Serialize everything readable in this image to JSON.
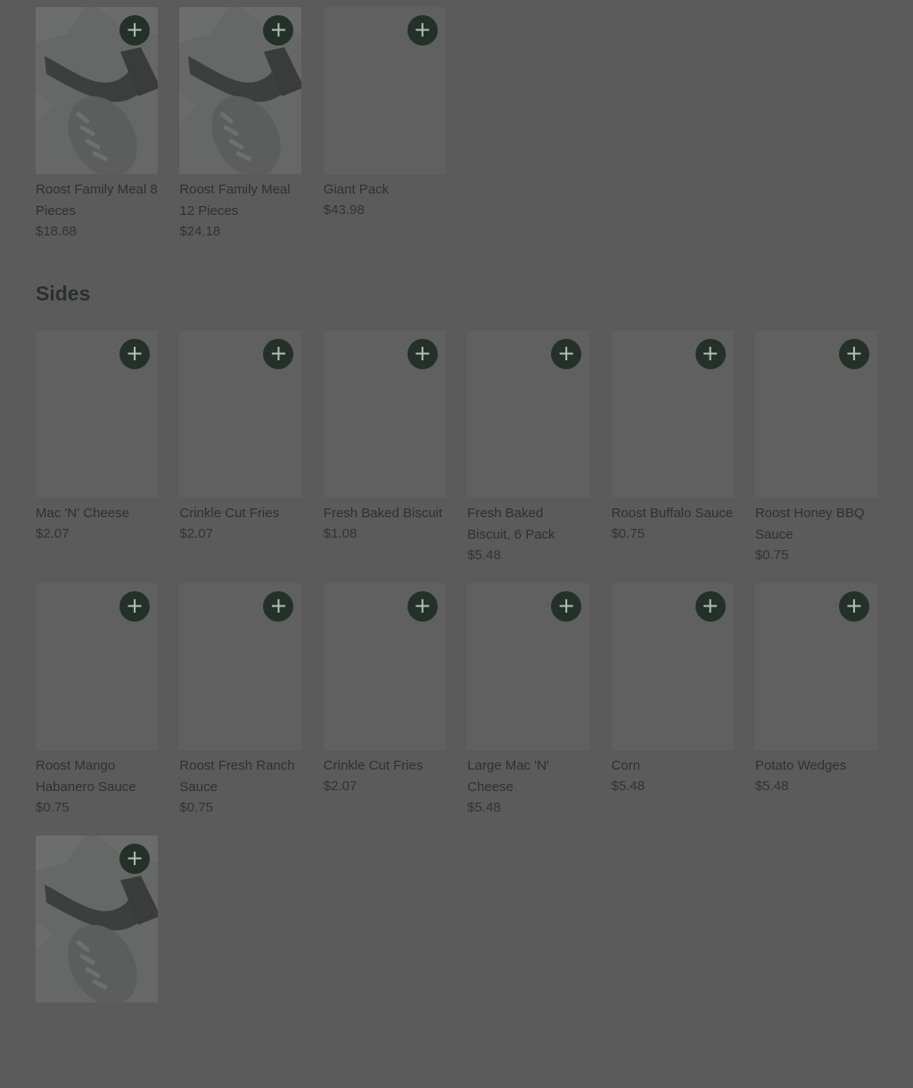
{
  "top_items": [
    {
      "name": "Roost Family Meal 8 Pieces",
      "price": "$18.68",
      "image": "chicken-photo"
    },
    {
      "name": "Roost Family Meal 12 Pieces",
      "price": "$24.18",
      "image": "chicken-photo"
    },
    {
      "name": "Giant Pack",
      "price": "$43.98",
      "image": "blank"
    }
  ],
  "sides": {
    "title": "Sides",
    "items": [
      {
        "name": "Mac 'N' Cheese",
        "price": "$2.07",
        "image": "blank"
      },
      {
        "name": "Crinkle Cut Fries",
        "price": "$2.07",
        "image": "blank"
      },
      {
        "name": "Fresh Baked Biscuit",
        "price": "$1.08",
        "image": "blank"
      },
      {
        "name": "Fresh Baked Biscuit, 6 Pack",
        "price": "$5.48",
        "image": "blank"
      },
      {
        "name": "Roost Buffalo Sauce",
        "price": "$0.75",
        "image": "blank"
      },
      {
        "name": "Roost Honey BBQ Sauce",
        "price": "$0.75",
        "image": "blank"
      },
      {
        "name": "Roost Mango Habanero Sauce",
        "price": "$0.75",
        "image": "blank"
      },
      {
        "name": "Roost Fresh Ranch Sauce",
        "price": "$0.75",
        "image": "blank"
      },
      {
        "name": "Crinkle Cut Fries",
        "price": "$2.07",
        "image": "blank"
      },
      {
        "name": "Large Mac 'N' Cheese",
        "price": "$5.48",
        "image": "blank"
      },
      {
        "name": "Corn",
        "price": "$5.48",
        "image": "blank"
      },
      {
        "name": "Potato Wedges",
        "price": "$5.48",
        "image": "blank"
      },
      {
        "name": "",
        "price": "",
        "image": "chicken-photo"
      }
    ]
  },
  "add_button_icon": "plus-icon",
  "add_button_glyph": "+",
  "colors": {
    "overlay_bg": "#5b5b5b",
    "add_button": "#233128"
  }
}
